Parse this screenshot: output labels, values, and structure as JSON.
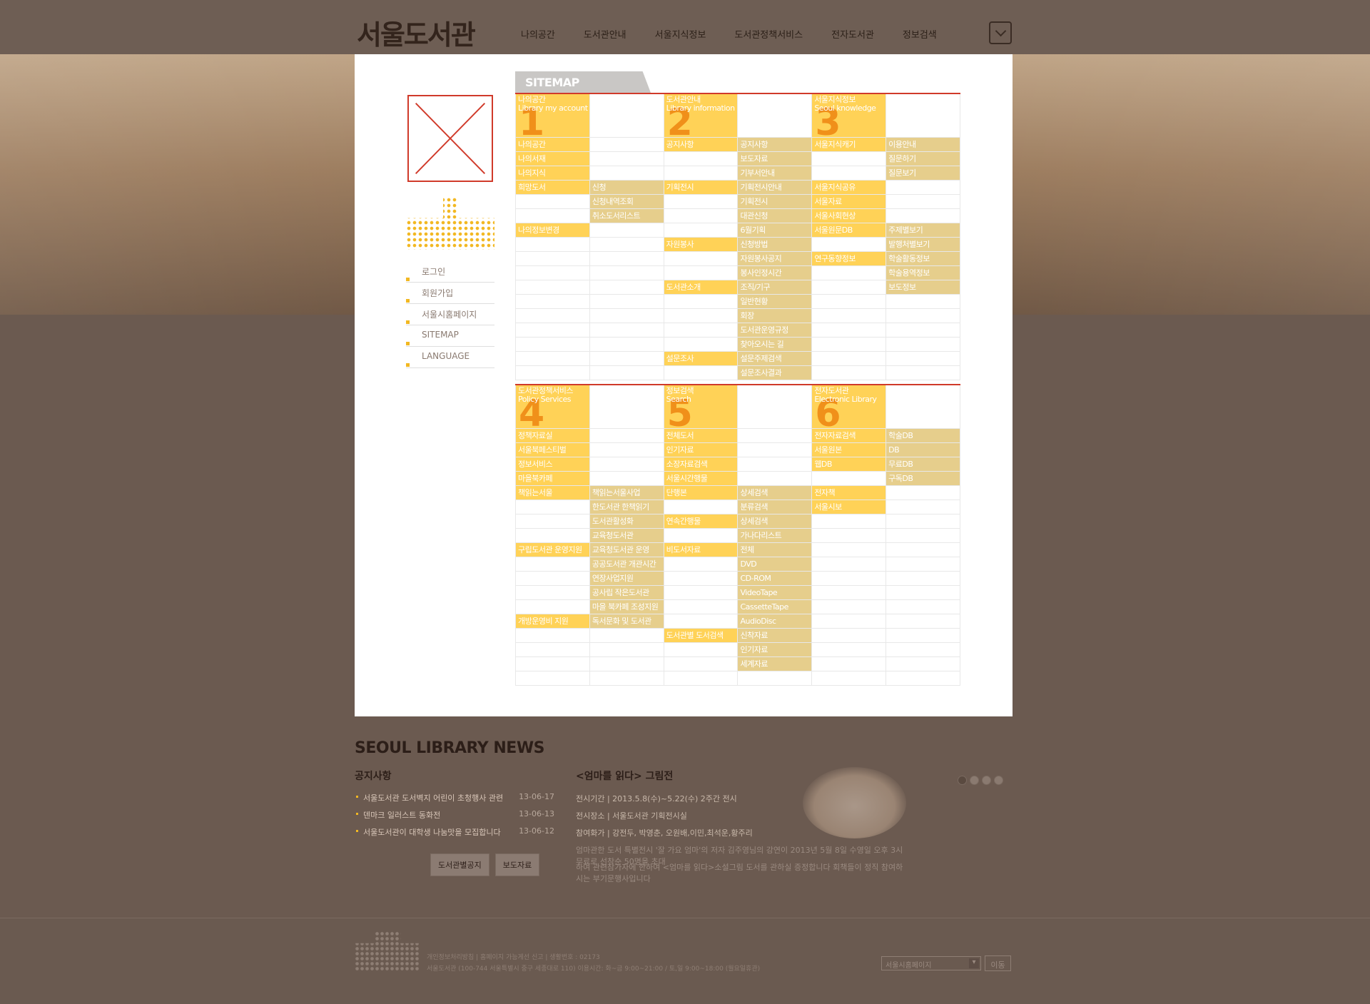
{
  "header": {
    "logo": "서울도서관",
    "nav": [
      "나의공간",
      "도서관안내",
      "서울지식정보",
      "도서관정책서비스",
      "전자도서관",
      "정보검색"
    ]
  },
  "sidebar": {
    "items": [
      "로그인",
      "회원가입",
      "서울시홈페이지",
      "SITEMAP",
      "LANGUAGE"
    ]
  },
  "sitemap": {
    "tab": "SITEMAP",
    "top": {
      "headers": [
        [
          "나의공간",
          "Library my account",
          "1"
        ],
        [
          "도서관안내",
          "Library information",
          "2"
        ],
        [
          "서울지식정보",
          "Seoul knowledge",
          "3"
        ]
      ],
      "rows": [
        [
          "나의공간",
          "",
          "공지사항",
          "공지사항",
          "서울지식캐기",
          "이용안내"
        ],
        [
          "나의서재",
          "",
          "",
          "보도자료",
          "",
          "질문하기"
        ],
        [
          "나의지식",
          "",
          "",
          "기부서안내",
          "",
          "질문보기"
        ],
        [
          "희망도서",
          "신청",
          "기획전시",
          "기획전시안내",
          "서울지식공유",
          ""
        ],
        [
          "",
          "신청내역조회",
          "",
          "기획전시",
          "서울자료",
          ""
        ],
        [
          "",
          "취소도서리스트",
          "",
          "대관신청",
          "서울사회현상",
          ""
        ],
        [
          "나의정보변경",
          "",
          "",
          "6월기획",
          "서울원문DB",
          "주제별보기"
        ],
        [
          "",
          "",
          "자원봉사",
          "신청방법",
          "",
          "발행처별보기"
        ],
        [
          "",
          "",
          "",
          "자원봉사공지",
          "연구동향정보",
          "학술활동정보"
        ],
        [
          "",
          "",
          "",
          "봉사인정시간",
          "",
          "학술용역정보"
        ],
        [
          "",
          "",
          "도서관소개",
          "조직/기구",
          "",
          "보도정보"
        ],
        [
          "",
          "",
          "",
          "일반현황",
          "",
          ""
        ],
        [
          "",
          "",
          "",
          "회장",
          "",
          ""
        ],
        [
          "",
          "",
          "",
          "도서관운영규정",
          "",
          ""
        ],
        [
          "",
          "",
          "",
          "찾아오시는 길",
          "",
          ""
        ],
        [
          "",
          "",
          "설문조사",
          "설문주제검색",
          "",
          ""
        ],
        [
          "",
          "",
          "",
          "설문조사결과",
          "",
          ""
        ]
      ]
    },
    "bottom": {
      "headers": [
        [
          "도서관정책서비스",
          "Policy Services",
          "4"
        ],
        [
          "정보검색",
          "Search",
          "5"
        ],
        [
          "전자도서관",
          "Electronic Library",
          "6"
        ]
      ],
      "rows": [
        [
          "정책자료실",
          "",
          "전체도서",
          "",
          "전자자료검색",
          "학술DB"
        ],
        [
          "서울북페스티벌",
          "",
          "인기자료",
          "",
          "서울원본",
          "DB"
        ],
        [
          "정보서비스",
          "",
          "소장자료검색",
          "",
          "웹DB",
          "무료DB"
        ],
        [
          "마을북카페",
          "",
          "서울시간행물",
          "",
          "",
          "구독DB"
        ],
        [
          "책읽는서울",
          "책읽는서울사업",
          "단행본",
          "상세검색",
          "전자책",
          ""
        ],
        [
          "",
          "한도서관 한책읽기",
          "",
          "분류검색",
          "서울시보",
          ""
        ],
        [
          "",
          "도서관활성화",
          "연속간행물",
          "상세검색",
          "",
          ""
        ],
        [
          "",
          "교육청도서관",
          "",
          "가나다리스트",
          "",
          ""
        ],
        [
          "구립도서관 운영지원",
          "교육청도서관 운영",
          "비도서자료",
          "전체",
          "",
          ""
        ],
        [
          "",
          "공공도서관 개관시간",
          "",
          "DVD",
          "",
          ""
        ],
        [
          "",
          "연장사업지원",
          "",
          "CD-ROM",
          "",
          ""
        ],
        [
          "",
          "공사립 작은도서관",
          "",
          "VideoTape",
          "",
          ""
        ],
        [
          "",
          "마을 북카페 조성지원",
          "",
          "CassetteTape",
          "",
          ""
        ],
        [
          "개방운영비 지원",
          "독서문화 및 도서관",
          "",
          "AudioDisc",
          "",
          ""
        ],
        [
          "",
          "",
          "도서관별 도서검색",
          "신착자료",
          "",
          ""
        ],
        [
          "",
          "",
          "",
          "인기자료",
          "",
          ""
        ],
        [
          "",
          "",
          "",
          "세계자료",
          "",
          ""
        ],
        [
          "",
          "",
          "",
          "",
          "",
          ""
        ]
      ]
    }
  },
  "news": {
    "heading": "SEOUL LIBRARY NEWS",
    "notice_title": "공지사항",
    "items": [
      {
        "t": "서울도서관 도서벽지 어린이 초청행사 관련",
        "d": "13-06-17"
      },
      {
        "t": "덴마크 일러스트 동화전",
        "d": "13-06-13"
      },
      {
        "t": "서울도서관이 대학생 나눔맛을 모집합니다",
        "d": "13-06-12"
      }
    ],
    "buttons": [
      "도서관별공지",
      "보도자료"
    ],
    "exhibit_title": "<엄마를 읽다> 그림전",
    "exhibit_lines": [
      "전시기간 | 2013.5.8(수)~5.22(수) 2주간 전시",
      "전시장소 | 서울도서관 기획전시실",
      "참여화가 | 강전두, 박영춘, 오원배,이민,최석운,황주리"
    ],
    "exhibit_desc": [
      "엄마관한 도서 특별전시 '잘 가요 엄마'의 저자 김주영님의 강연이 2013년 5월 8일 수영일 오후 3시 무료로 선착순 50명을 초대",
      "하여 관련참가자에 한하여 <엄마를 읽다>소설그림 도서를 관하실 증정합니다 회책들이 정직 참여하시는 부기문행사입니다"
    ]
  },
  "footer": {
    "line1": "개인정보처리방침  |  홈페이지 가능게선 신고  |  생활번호 : 02173",
    "line2": "서울도서관 (100-744 서울특별시 중구 세종대로 110) 이용시간: 화~금 9:00~21:00 / 토,일 9:00~18:00 (월요일휴관)",
    "select": "서울시홈페이지",
    "go": "이동"
  }
}
